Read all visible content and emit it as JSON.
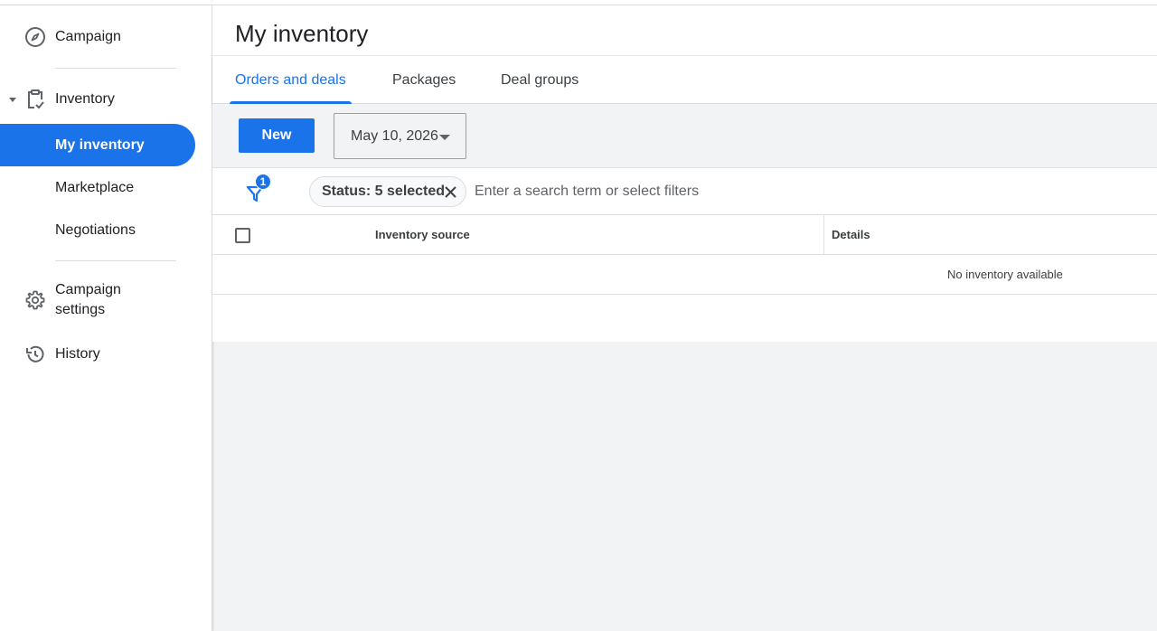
{
  "sidebar": {
    "campaign_label": "Campaign",
    "inventory_label": "Inventory",
    "sub_items": [
      "My inventory",
      "Marketplace",
      "Negotiations"
    ],
    "campaign_settings_line1": "Campaign",
    "campaign_settings_line2": "settings",
    "history_label": "History"
  },
  "header": {
    "title": "My inventory"
  },
  "tabs": [
    "Orders and deals",
    "Packages",
    "Deal groups"
  ],
  "toolbar": {
    "new_label": "New",
    "date_value": "May 10, 2026"
  },
  "filters": {
    "badge_count": "1",
    "chip_label": "Status: 5 selected",
    "search_placeholder": "Enter a search term or select filters"
  },
  "table": {
    "columns": [
      "Inventory source",
      "Details"
    ],
    "empty_message": "No inventory available"
  },
  "colors": {
    "accent": "#1a73e8",
    "background": "#f1f3f4"
  }
}
